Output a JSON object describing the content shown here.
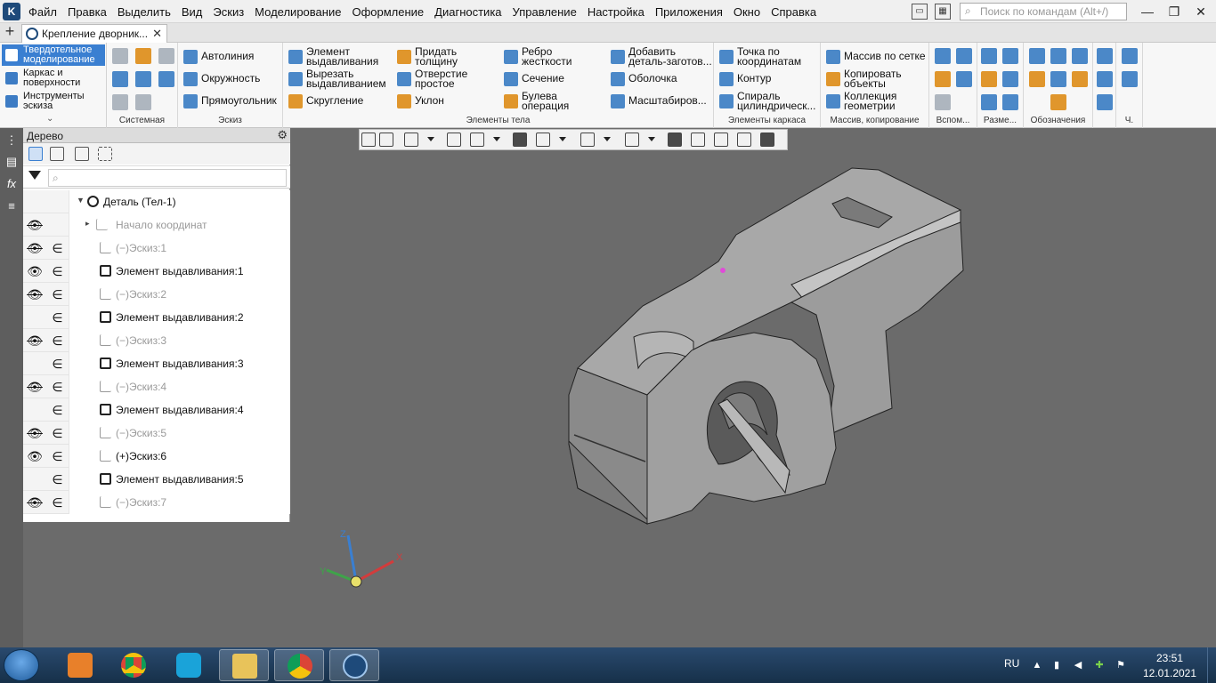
{
  "menubar": {
    "logo": "K",
    "items": [
      "Файл",
      "Правка",
      "Выделить",
      "Вид",
      "Эскиз",
      "Моделирование",
      "Оформление",
      "Диагностика",
      "Управление",
      "Настройка",
      "Приложения",
      "Окно",
      "Справка"
    ],
    "search_placeholder": "Поиск по командам (Alt+/)"
  },
  "tabs": {
    "add_label": "+",
    "document_title": "Крепление дворник...",
    "close_label": "✕"
  },
  "ribbon": {
    "modes": [
      "Твердотельное моделирование",
      "Каркас и поверхности",
      "Инструменты эскиза"
    ],
    "groups": {
      "system": {
        "label": "Системная"
      },
      "sketch": {
        "label": "Эскиз",
        "buttons": [
          "Автолиния",
          "Окружность",
          "Прямоугольник"
        ]
      },
      "body": {
        "label": "Элементы тела",
        "buttons": [
          "Элемент выдавливания",
          "Вырезать выдавливанием",
          "Скругление",
          "Придать толщину",
          "Отверстие простое",
          "Уклон",
          "Ребро жесткости",
          "Сечение",
          "Булева операция",
          "Добавить деталь-заготов...",
          "Оболочка",
          "Масштабиров..."
        ]
      },
      "frame": {
        "label": "Элементы каркаса",
        "buttons": [
          "Точка по координатам",
          "Контур",
          "Спираль цилиндрическ..."
        ]
      },
      "array": {
        "label": "Массив, копирование",
        "buttons": [
          "Массив по сетке",
          "Копировать объекты",
          "Коллекция геометрии"
        ]
      },
      "aux": {
        "label": "Вспом..."
      },
      "dims": {
        "label": "Разме..."
      },
      "notes": {
        "label": "Обозначения"
      },
      "last": {
        "label": "Ч."
      }
    }
  },
  "tree": {
    "title": "Дерево",
    "filter_placeholder": "⌕",
    "rows": [
      {
        "eye": "",
        "e": "",
        "label": "Деталь (Тел-1)",
        "kind": "part",
        "style": "dark",
        "indent": 1
      },
      {
        "eye": "hidden",
        "e": "",
        "label": "Начало координат",
        "kind": "origin",
        "style": "gray",
        "indent": 2
      },
      {
        "eye": "hidden",
        "e": "∈",
        "label": "(−)Эскиз:1",
        "kind": "sketch",
        "style": "gray",
        "indent": 3
      },
      {
        "eye": "visible",
        "e": "∈",
        "label": "Элемент выдавливания:1",
        "kind": "feature",
        "style": "dark",
        "indent": 3
      },
      {
        "eye": "hidden",
        "e": "∈",
        "label": "(−)Эскиз:2",
        "kind": "sketch",
        "style": "gray",
        "indent": 3
      },
      {
        "eye": "",
        "e": "∈",
        "label": "Элемент выдавливания:2",
        "kind": "feature",
        "style": "dark",
        "indent": 3
      },
      {
        "eye": "hidden",
        "e": "∈",
        "label": "(−)Эскиз:3",
        "kind": "sketch",
        "style": "gray",
        "indent": 3
      },
      {
        "eye": "",
        "e": "∈",
        "label": "Элемент выдавливания:3",
        "kind": "feature",
        "style": "dark",
        "indent": 3
      },
      {
        "eye": "hidden",
        "e": "∈",
        "label": "(−)Эскиз:4",
        "kind": "sketch",
        "style": "gray",
        "indent": 3
      },
      {
        "eye": "",
        "e": "∈",
        "label": "Элемент выдавливания:4",
        "kind": "feature",
        "style": "dark",
        "indent": 3
      },
      {
        "eye": "hidden",
        "e": "∈",
        "label": "(−)Эскиз:5",
        "kind": "sketch",
        "style": "gray",
        "indent": 3
      },
      {
        "eye": "visible",
        "e": "∈",
        "label": "(+)Эскиз:6",
        "kind": "sketch",
        "style": "dark",
        "indent": 3
      },
      {
        "eye": "",
        "e": "∈",
        "label": "Элемент выдавливания:5",
        "kind": "feature",
        "style": "dark",
        "indent": 3
      },
      {
        "eye": "hidden",
        "e": "∈",
        "label": "(−)Эскиз:7",
        "kind": "sketch",
        "style": "gray",
        "indent": 3
      }
    ]
  },
  "viewport": {
    "axes": {
      "x": "X",
      "y": "Y",
      "z": "Z"
    },
    "model_color": "#9a9a9a",
    "background_color": "#6b6b6b"
  },
  "taskbar": {
    "lang": "RU",
    "time": "23:51",
    "date": "12.01.2021"
  },
  "colors": {
    "accent": "#3a7fd1",
    "brand": "#1e4a7a"
  }
}
